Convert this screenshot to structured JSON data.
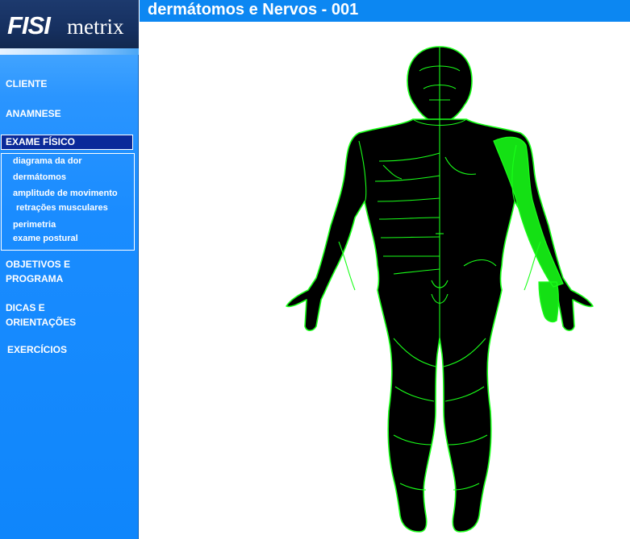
{
  "logo": {
    "bold": "FISI",
    "thin": "metrix"
  },
  "menu": {
    "cliente": "CLIENTE",
    "anamnese": "ANAMNESE",
    "exame_fisico": "EXAME FÍSICO",
    "objetivos_1": "OBJETIVOS E",
    "objetivos_2": "PROGRAMA",
    "dicas_1": "DICAS E",
    "dicas_2": "ORIENTAÇÕES",
    "exercicios": "EXERCÍCIOS"
  },
  "submenu": [
    "diagrama da dor",
    "dermátomos",
    "amplitude de movimento",
    "retrações musculares",
    "perimetria",
    "exame postural"
  ],
  "page_title": "dermátomos e Nervos - 001",
  "colors": {
    "line": "#19ff19",
    "highlight": "#14e014",
    "body": "#000000",
    "title_bar": "#0c87f2"
  }
}
